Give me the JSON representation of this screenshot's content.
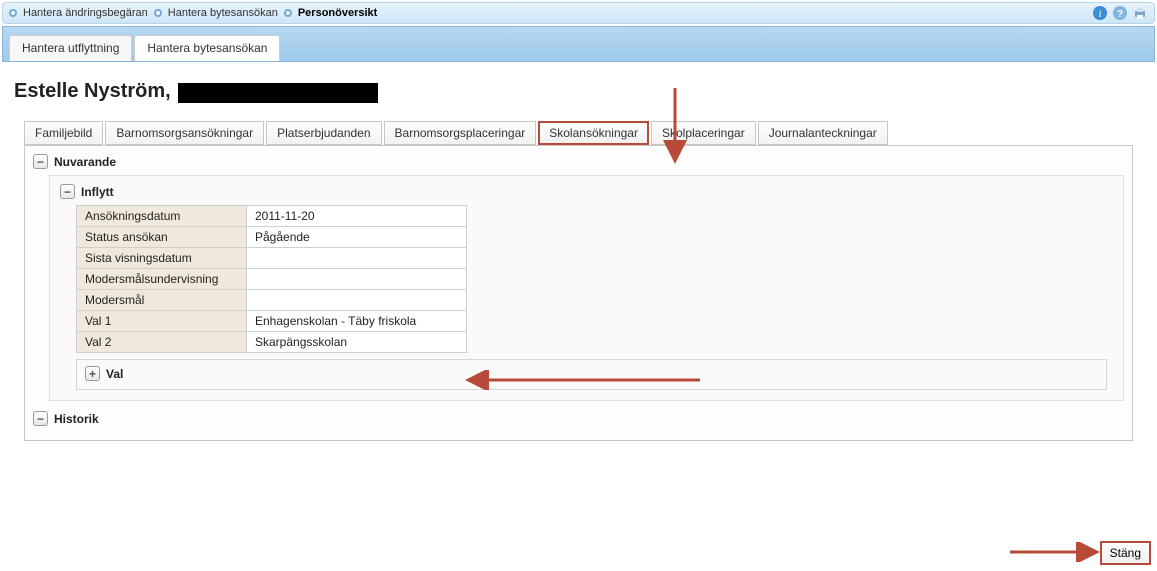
{
  "breadcrumb": {
    "items": [
      {
        "label": "Hantera ändringsbegäran",
        "active": false
      },
      {
        "label": "Hantera bytesansökan",
        "active": false
      },
      {
        "label": "Personöversikt",
        "active": true
      }
    ]
  },
  "icons": {
    "info": "info-icon",
    "help": "help-icon",
    "print": "print-icon"
  },
  "maintabs": [
    {
      "label": "Hantera utflyttning",
      "active": false
    },
    {
      "label": "Hantera bytesansökan",
      "active": true
    }
  ],
  "page": {
    "title_prefix": "Estelle Nyström, "
  },
  "innertabs": [
    {
      "label": "Familjebild"
    },
    {
      "label": "Barnomsorgsansökningar"
    },
    {
      "label": "Platserbjudanden"
    },
    {
      "label": "Barnomsorgsplaceringar"
    },
    {
      "label": "Skolansökningar",
      "selected": true
    },
    {
      "label": "Skolplaceringar"
    },
    {
      "label": "Journalanteckningar"
    }
  ],
  "sections": {
    "current": {
      "label": "Nuvarande",
      "expanded": true
    },
    "inflytt": {
      "label": "Inflytt",
      "expanded": true,
      "rows": [
        {
          "key": "Ansökningsdatum",
          "val": "2011-11-20"
        },
        {
          "key": "Status ansökan",
          "val": "Pågående"
        },
        {
          "key": "Sista visningsdatum",
          "val": ""
        },
        {
          "key": "Modersmålsundervisning",
          "val": ""
        },
        {
          "key": "Modersmål",
          "val": ""
        },
        {
          "key": "Val 1",
          "val": "Enhagenskolan - Täby friskola"
        },
        {
          "key": "Val 2",
          "val": "Skarpängsskolan"
        }
      ]
    },
    "val": {
      "label": "Val",
      "expanded": false
    },
    "history": {
      "label": "Historik",
      "expanded": true
    }
  },
  "buttons": {
    "close": "Stäng"
  },
  "collapse_glyphs": {
    "minus": "−",
    "plus": "+"
  }
}
